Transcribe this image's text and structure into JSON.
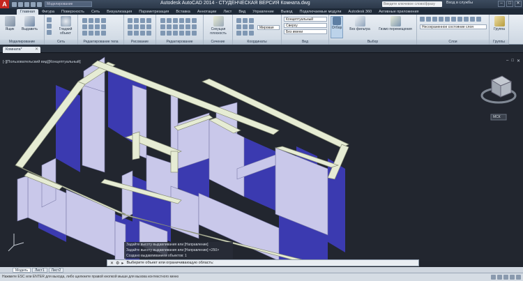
{
  "titlebar": {
    "logo": "A",
    "workspace": "Моделирование",
    "title": "Autodesk AutoCAD 2014 - СТУДЕНЧЕСКАЯ ВЕРСИЯ   Комната.dwg",
    "search_placeholder": "Введите ключевое слово/фразу",
    "signin": "Вход в службы",
    "min": "–",
    "max": "□",
    "close": "✕"
  },
  "tabs": [
    "Главная",
    "Фигура",
    "Поверхность",
    "Сеть",
    "Визуализация",
    "Параметризация",
    "Вставка",
    "Аннотации",
    "Лист",
    "Вид",
    "Управление",
    "Вывод",
    "Подключаемые модули",
    "Autodesk 360",
    "Активные приложения"
  ],
  "ribbon": {
    "panels": {
      "modeling": "Моделирование",
      "mesh": "Сеть",
      "solid_edit": "Редактирование тела",
      "draw": "Рисование",
      "modify": "Редактирование",
      "section": "Сечение",
      "coordinates": "Координаты",
      "view": "Вид",
      "selection": "Выбор",
      "layers": "Слои",
      "groups": "Группы"
    },
    "buttons": {
      "box": "Ящик",
      "extrude": "Выдавить",
      "smooth": "Гладкий объект",
      "section_plane": "Секущая плоскость",
      "filter": "Отбор",
      "no_filter": "Без фильтра",
      "gizmo": "Гизмо перемещения",
      "group": "Группа"
    },
    "dropdowns": {
      "visual_style": "Концептуальный",
      "view": "Сверху",
      "no_name": "Без имени",
      "global": "Мировая",
      "layer_state": "Несохраненное состояние слоя"
    }
  },
  "file_tab": {
    "name": "Комната*",
    "close": "✕"
  },
  "viewport": {
    "label": "[-][Пользовательский вид][Концептуальный]",
    "controls": [
      "–",
      "□",
      "✕"
    ],
    "cube_label": "ЮЗ",
    "wcs": "МСК"
  },
  "command": {
    "history": [
      "Задайте высоту выдавливания или [Направление]",
      "Задайте высоту выдавливания или [Направление] <250>",
      "Создано выдавливанием объектов: 1"
    ],
    "prompt": "Выберите объект или ограничивающую область:"
  },
  "layout_tabs": [
    "Модель",
    "Лист1",
    "Лист2"
  ],
  "status": "Нажмите ESC или ENTER для выхода, либо щелкните правой кнопкой мыши для вызова контекстного меню",
  "colors": {
    "wall_top": "#e6ecd4",
    "wall_face": "#c9c8ea",
    "wall_shadow": "#3d3cb0",
    "viewport_bg": "#22262f"
  }
}
